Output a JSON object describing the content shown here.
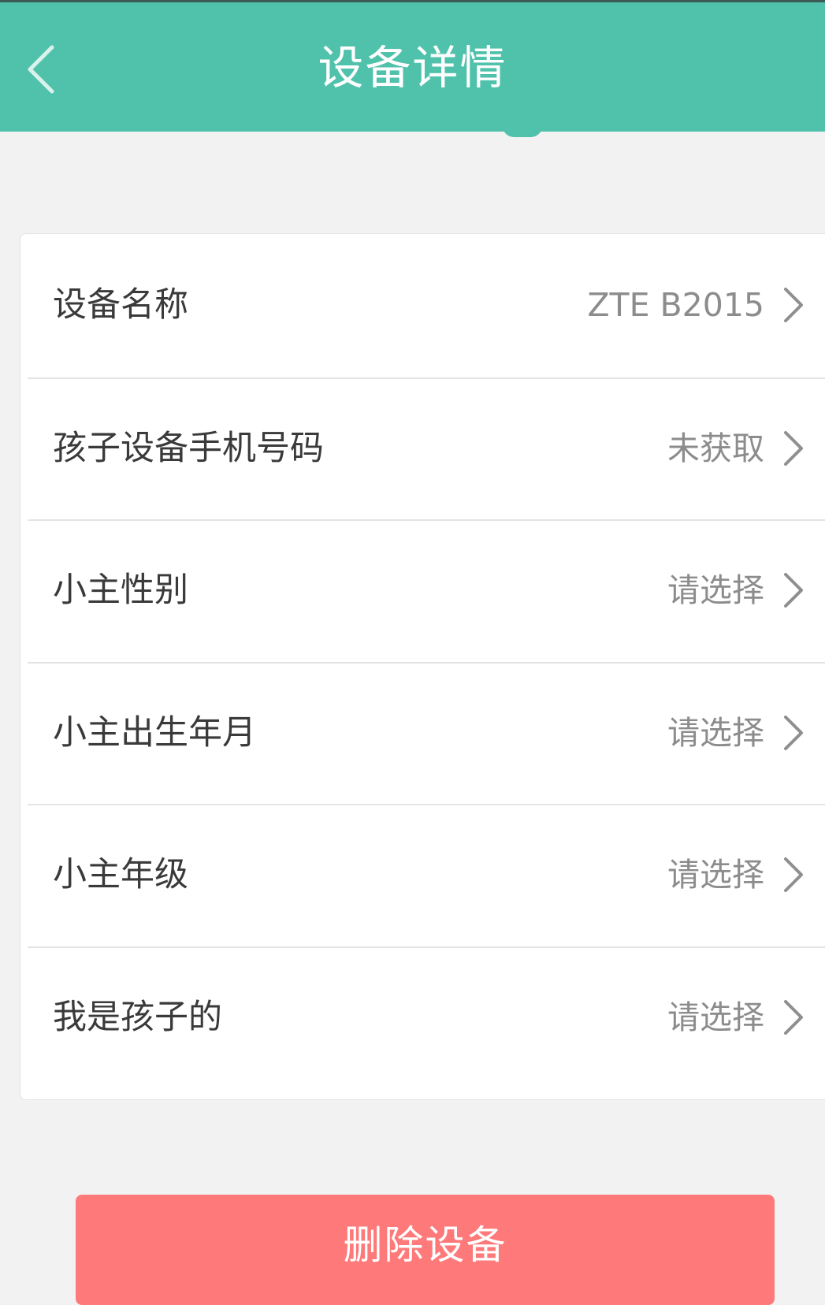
{
  "header": {
    "title": "设备详情",
    "back_icon": "chevron-left-icon",
    "background_color": "#50c2ab"
  },
  "rows": [
    {
      "label": "设备名称",
      "value": "ZTE B2015",
      "icon": "chevron-right-icon"
    },
    {
      "label": "孩子设备手机号码",
      "value": "未获取",
      "icon": "chevron-right-icon"
    },
    {
      "label": "小主性别",
      "value": "请选择",
      "icon": "chevron-right-icon"
    },
    {
      "label": "小主出生年月",
      "value": "请选择",
      "icon": "chevron-right-icon"
    },
    {
      "label": "小主年级",
      "value": "请选择",
      "icon": "chevron-right-icon"
    },
    {
      "label": "我是孩子的",
      "value": "请选择",
      "icon": "chevron-right-icon"
    }
  ],
  "delete_button": {
    "label": "删除设备",
    "color": "#fe7979"
  }
}
